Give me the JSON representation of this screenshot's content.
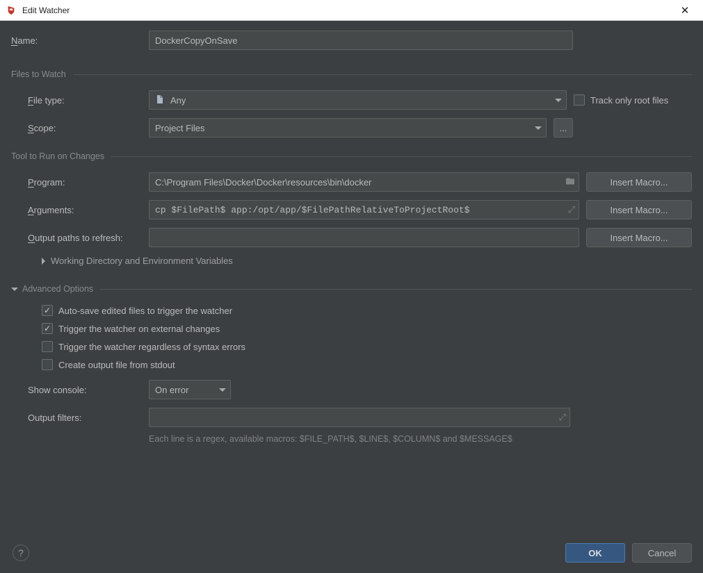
{
  "window": {
    "title": "Edit Watcher"
  },
  "name": {
    "label_pre": "N",
    "label_post": "ame:",
    "value": "DockerCopyOnSave"
  },
  "sections": {
    "files_to_watch": "Files to Watch",
    "tool_to_run": "Tool to Run on Changes",
    "advanced": "Advanced Options"
  },
  "file_type": {
    "label_pre": "F",
    "label_post": "ile type:",
    "value": "Any"
  },
  "track_root": {
    "label": "Track only root files",
    "checked": false
  },
  "scope": {
    "label_pre": "S",
    "label_post": "cope:",
    "value": "Project Files",
    "browse": "..."
  },
  "program": {
    "label_pre": "P",
    "label_post": "rogram:",
    "value": "C:\\Program Files\\Docker\\Docker\\resources\\bin\\docker"
  },
  "arguments": {
    "label_pre": "A",
    "label_post": "rguments:",
    "value": "cp $FilePath$ app:/opt/app/$FilePathRelativeToProjectRoot$"
  },
  "output_paths": {
    "label_pre": "O",
    "label_post": "utput paths to refresh:",
    "value": ""
  },
  "insert_macro": "Insert Macro...",
  "working_env": "Working Directory and Environment Variables",
  "adv": {
    "auto_save": {
      "label": "Auto-save edited files to trigger the watcher",
      "checked": true
    },
    "external": {
      "label": "Trigger the watcher on external changes",
      "checked": true
    },
    "syntax": {
      "label": "Trigger the watcher regardless of syntax errors",
      "checked": false
    },
    "stdout": {
      "label": "Create output file from stdout",
      "checked": false
    }
  },
  "show_console": {
    "label": "Show console:",
    "value": "On error"
  },
  "output_filters": {
    "label": "Output filters:",
    "value": "",
    "hint": "Each line is a regex, available macros: $FILE_PATH$, $LINE$, $COLUMN$ and $MESSAGE$"
  },
  "buttons": {
    "ok": "OK",
    "cancel": "Cancel"
  }
}
